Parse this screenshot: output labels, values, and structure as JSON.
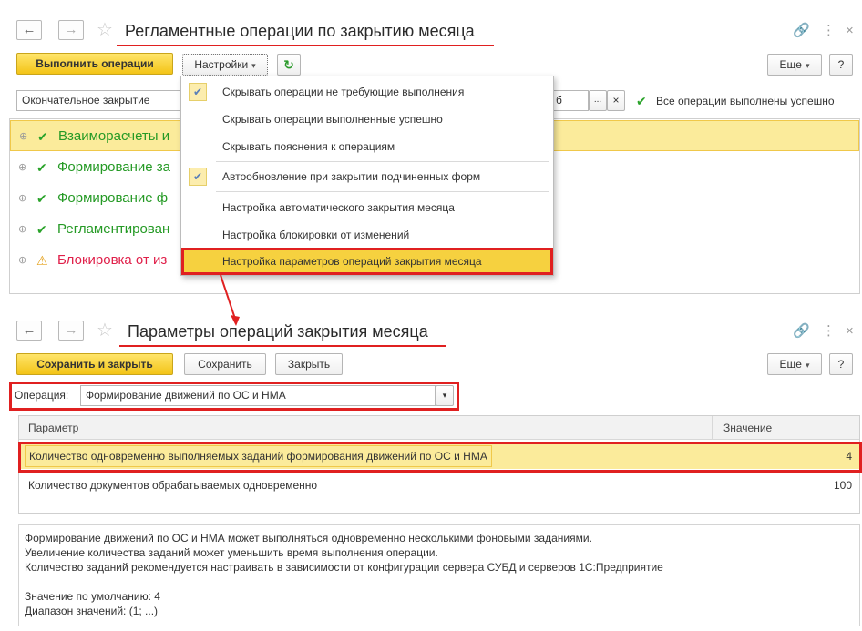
{
  "window1": {
    "title": "Регламентные операции по закрытию месяца",
    "run_button": "Выполнить операции",
    "settings_button": "Настройки",
    "refresh_icon": "refresh-icon",
    "more_button": "Еще",
    "help_button": "?",
    "closing_type_value": "Окончательное закрытие",
    "period_fragment": "б",
    "period_dots": "...",
    "period_clear": "×",
    "status_text": "Все операции выполнены успешно",
    "operations": [
      {
        "label": "Взаиморасчеты и",
        "state": "ok",
        "selected": true
      },
      {
        "label": "Формирование за",
        "state": "ok",
        "selected": false
      },
      {
        "label": "Формирование ф",
        "state": "ok",
        "selected": false
      },
      {
        "label": "Регламентирован",
        "state": "ok",
        "selected": false
      },
      {
        "label": "Блокировка от из",
        "state": "warn",
        "selected": false
      }
    ]
  },
  "settings_menu": {
    "items": [
      {
        "label": "Скрывать операции не требующие выполнения",
        "checked": true
      },
      {
        "label": "Скрывать операции выполненные успешно",
        "checked": false
      },
      {
        "label": "Скрывать пояснения к операциям",
        "checked": false
      },
      {
        "label": "Автообновление при закрытии подчиненных форм",
        "checked": true
      },
      {
        "label": "Настройка автоматического закрытия месяца",
        "checked": false
      },
      {
        "label": "Настройка блокировки от изменений",
        "checked": false
      },
      {
        "label": "Настройка параметров операций закрытия месяца",
        "checked": false
      }
    ]
  },
  "window2": {
    "title": "Параметры операций закрытия месяца",
    "save_close_button": "Сохранить и закрыть",
    "save_button": "Сохранить",
    "close_button": "Закрыть",
    "more_button": "Еще",
    "help_button": "?",
    "operation_label": "Операция:",
    "operation_value": "Формирование движений по ОС и НМА",
    "grid_headers": {
      "param": "Параметр",
      "value": "Значение"
    },
    "rows": [
      {
        "param": "Количество одновременно выполняемых заданий формирования движений по ОС и НМА",
        "value": "4"
      },
      {
        "param": "Количество документов обрабатываемых одновременно",
        "value": "100"
      }
    ],
    "description": [
      "Формирование движений по ОС и НМА может выполняться одновременно несколькими фоновыми заданиями.",
      "Увеличение количества заданий может уменьшить время выполнения операции.",
      "Количество заданий рекомендуется настраивать в зависимости от конфигурации сервера СУБД и серверов 1С:Предприятие",
      "",
      "Значение по умолчанию: 4",
      "Диапазон значений: (1; ...)"
    ]
  },
  "colors": {
    "primary_button": "#f3c417",
    "highlight_red": "#e02020",
    "ok_green": "#2aa32a",
    "warn_red": "#e0204a",
    "selection_yellow": "#fbeb9b"
  }
}
